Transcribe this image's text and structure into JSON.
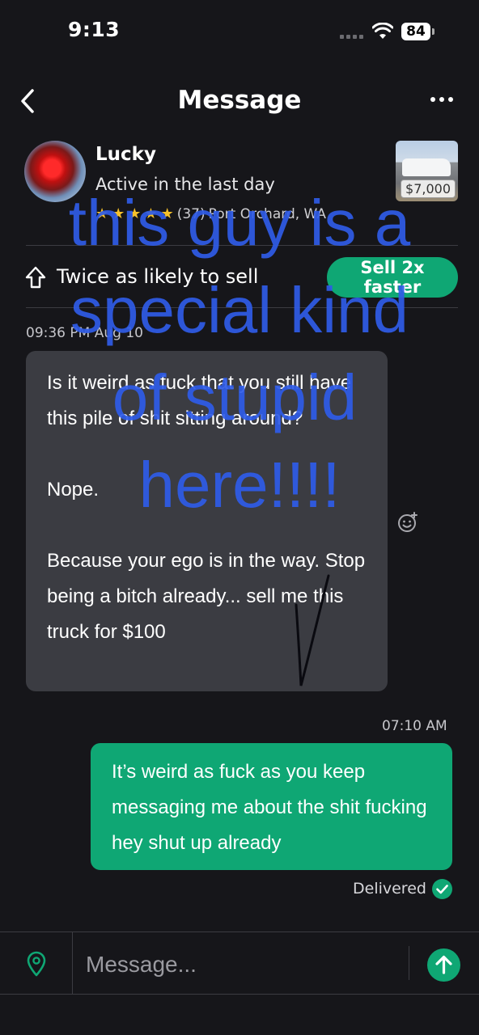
{
  "status_bar": {
    "time": "9:13",
    "battery": "84"
  },
  "header": {
    "title": "Message"
  },
  "seller": {
    "name": "Lucky",
    "activity": "Active in the last day",
    "rating_count": "(37)",
    "location": "Port Orchard, WA",
    "listing_price": "$7,000"
  },
  "sell_banner": {
    "text": "Twice as likely to sell",
    "button_label": "Sell 2x faster"
  },
  "messages": [
    {
      "direction": "incoming",
      "timestamp": "09:36 PM Aug 10",
      "text": "Is it weird as fuck that you still have this pile of shit sitting around?\n\nNope.\n\nBecause your ego is in the way. Stop being a bitch already... sell me this truck for $100"
    },
    {
      "direction": "outgoing",
      "timestamp": "07:10 AM",
      "text": "It’s weird as fuck as you keep messaging me about the shit fucking hey shut up already",
      "status": "Delivered"
    }
  ],
  "composer": {
    "placeholder": "Message..."
  },
  "overlay_text": [
    "this guy is a",
    "special kind",
    "of stupid",
    "here!!!!"
  ],
  "colors": {
    "accent": "#0fa774",
    "overlay": "#2f5ce8",
    "background": "#16161a"
  }
}
